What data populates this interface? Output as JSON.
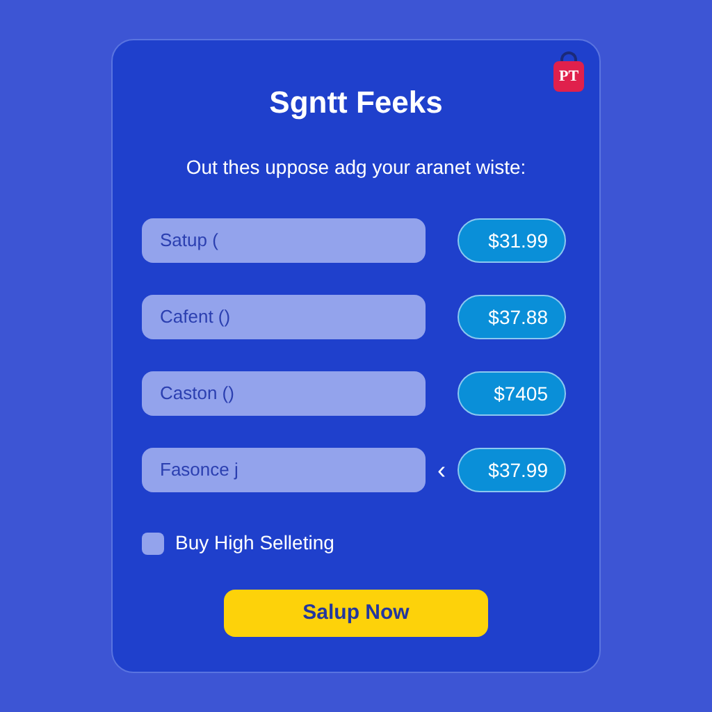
{
  "badge": "PT",
  "title": "Sgntt Feeks",
  "subtitle": "Out thes uppose adg your aranet wiste:",
  "rows": [
    {
      "field": "Satup (",
      "price": "$31.99"
    },
    {
      "field": "Cafent ()",
      "price": "$37.88"
    },
    {
      "field": "Caston ()",
      "price": "$7405"
    },
    {
      "field": "Fasonce j",
      "price": "$37.99",
      "marker": "‹"
    }
  ],
  "checkbox": {
    "label": "Buy High Selleting",
    "checked": false
  },
  "button": "Salup Now"
}
